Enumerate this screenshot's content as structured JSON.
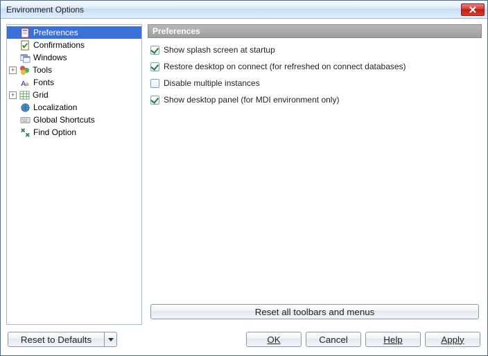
{
  "title": "Environment Options",
  "tree": {
    "items": [
      {
        "label": "Preferences",
        "selected": true,
        "expander": null
      },
      {
        "label": "Confirmations",
        "expander": null
      },
      {
        "label": "Windows",
        "expander": null
      },
      {
        "label": "Tools",
        "expander": "plus"
      },
      {
        "label": "Fonts",
        "expander": null
      },
      {
        "label": "Grid",
        "expander": "plus"
      },
      {
        "label": "Localization",
        "expander": null
      },
      {
        "label": "Global Shortcuts",
        "expander": null
      },
      {
        "label": "Find Option",
        "expander": null
      }
    ]
  },
  "pane": {
    "header": "Preferences",
    "options": [
      {
        "label": "Show splash screen at startup",
        "checked": true
      },
      {
        "label": "Restore desktop on connect (for refreshed on connect databases)",
        "checked": true
      },
      {
        "label": "Disable multiple instances",
        "checked": false
      },
      {
        "label": "Show desktop panel (for MDI environment only)",
        "checked": true
      }
    ],
    "reset_button": "Reset all toolbars and menus"
  },
  "footer": {
    "reset_defaults": "Reset to Defaults",
    "ok": "OK",
    "cancel": "Cancel",
    "help": "Help",
    "apply": "Apply"
  }
}
